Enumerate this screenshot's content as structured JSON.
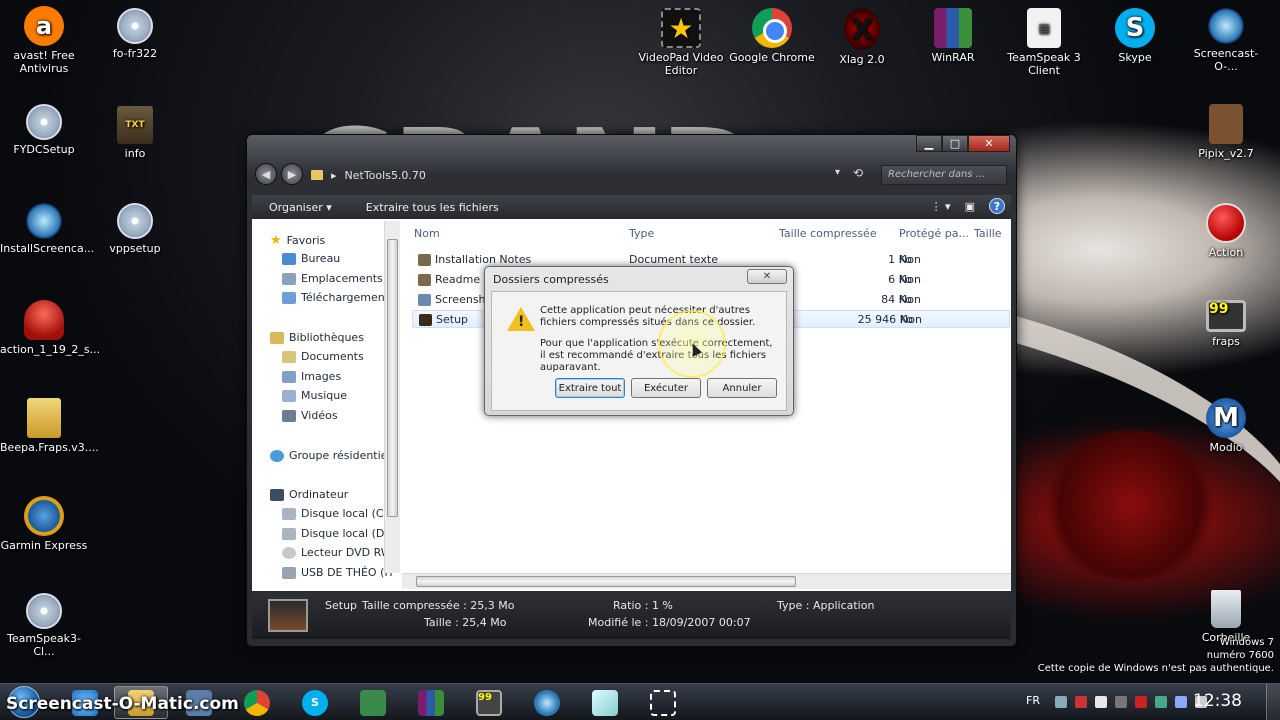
{
  "desktop": {
    "icons_left": [
      {
        "label": "avast! Free Antivirus",
        "icon": "avast-icon"
      },
      {
        "label": "FYDCSetup",
        "icon": "cd-installer-icon"
      },
      {
        "label": "InstallScreenca...",
        "icon": "screencast-icon"
      },
      {
        "label": "action_1_19_2_s...",
        "icon": "action-installer-icon"
      },
      {
        "label": "Beepa.Fraps.v3....",
        "icon": "zip-folder-icon"
      },
      {
        "label": "Garmin Express",
        "icon": "garmin-icon"
      },
      {
        "label": "TeamSpeak3-Cl...",
        "icon": "cd-installer-icon"
      }
    ],
    "icons_col2": [
      {
        "label": "fo-fr322",
        "icon": "cd-installer-icon"
      },
      {
        "label": "info",
        "icon": "text-file-icon"
      },
      {
        "label": "vppsetup",
        "icon": "cd-installer-icon"
      }
    ],
    "icons_top": [
      {
        "label": "VideoPad Video Editor",
        "icon": "videopad-icon"
      },
      {
        "label": "Google Chrome",
        "icon": "chrome-icon"
      },
      {
        "label": "Xlag 2.0",
        "icon": "xlag-icon"
      },
      {
        "label": "WinRAR",
        "icon": "winrar-icon"
      },
      {
        "label": "TeamSpeak 3 Client",
        "icon": "teamspeak-icon"
      },
      {
        "label": "Skype",
        "icon": "skype-icon"
      },
      {
        "label": "Screencast-O-...",
        "icon": "screencast-icon"
      }
    ],
    "icons_right": [
      {
        "label": "Pipix_v2.7",
        "icon": "minecraft-icon"
      },
      {
        "label": "Action",
        "icon": "record-icon"
      },
      {
        "label": "fraps",
        "icon": "fraps-icon"
      },
      {
        "label": "Modio",
        "icon": "modio-icon"
      },
      {
        "label": "Corbeille",
        "icon": "recycle-bin-icon"
      }
    ],
    "fraps_counter": "99",
    "windows_info": {
      "line1": "Windows 7",
      "line2": "numéro 7600",
      "line3": "Cette copie de Windows n'est pas authentique."
    }
  },
  "explorer": {
    "address": "NetTools5.0.70",
    "search_placeholder": "Rechercher dans ...",
    "toolbar": {
      "organize": "Organiser",
      "extract_all": "Extraire tous les fichiers"
    },
    "nav": {
      "favorites": "Favoris",
      "favorites_items": [
        "Bureau",
        "Emplacements ré",
        "Téléchargements"
      ],
      "libraries": "Bibliothèques",
      "libraries_items": [
        "Documents",
        "Images",
        "Musique",
        "Vidéos"
      ],
      "homegroup": "Groupe résidentiel",
      "computer": "Ordinateur",
      "computer_items": [
        "Disque local (C:)",
        "Disque local (D:)",
        "Lecteur DVD RW",
        "USB DE THÉO (H"
      ]
    },
    "columns": {
      "name": "Nom",
      "type": "Type",
      "compressed": "Taille compressée",
      "protected": "Protégé pa...",
      "size": "Taille"
    },
    "files": [
      {
        "name": "Installation Notes",
        "type": "Document texte",
        "compressed": "1 Ko",
        "protected": "Non"
      },
      {
        "name": "Readme",
        "type": "",
        "compressed": "6 Ko",
        "protected": "Non"
      },
      {
        "name": "Screensho",
        "type": "",
        "compressed": "84 Ko",
        "protected": "Non"
      },
      {
        "name": "Setup",
        "type": "",
        "compressed": "25 946 Ko",
        "protected": "Non"
      }
    ],
    "details": {
      "name": "Setup",
      "compressed": "Taille compressée : 25,3 Mo",
      "size": "Taille : 25,4 Mo",
      "ratio": "Ratio : 1 %",
      "modified": "Modifié le : 18/09/2007 00:07",
      "type": "Type : Application"
    }
  },
  "dialog": {
    "title": "Dossiers compressés",
    "close": "✕",
    "msg1": "Cette application peut nécessiter d'autres fichiers compressés situés dans ce dossier.",
    "msg2": "Pour que l'application s'exécute correctement, il est recommandé d'extraire tous les fichiers auparavant.",
    "buttons": {
      "extract": "Extraire tout",
      "run": "Exécuter",
      "cancel": "Annuler"
    }
  },
  "taskbar": {
    "watermark": "Screencast-O-Matic.com",
    "language": "FR",
    "clock": "12:38",
    "fraps_badge": "99"
  }
}
